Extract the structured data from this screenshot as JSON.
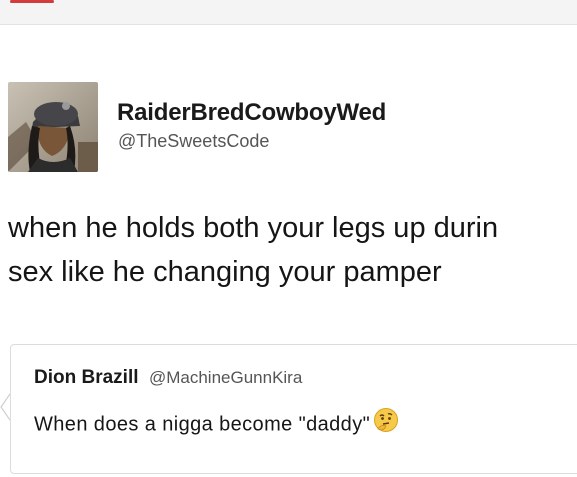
{
  "tweet": {
    "display_name": "RaiderBredCowboyWed",
    "handle": "@TheSweetsCode",
    "avatar_icon": "profile-photo",
    "lines": [
      "when he holds both your legs up durin",
      "sex like he changing your pamper"
    ]
  },
  "quoted_tweet": {
    "display_name": "Dion Brazill",
    "handle": "@MachineGunnKira",
    "text": "When does a nigga become \"daddy\"",
    "emoji_icon": "thinking-face-emoji"
  },
  "colors": {
    "text": "#151515",
    "secondary_text": "#555555",
    "border": "#dcdcdc"
  }
}
